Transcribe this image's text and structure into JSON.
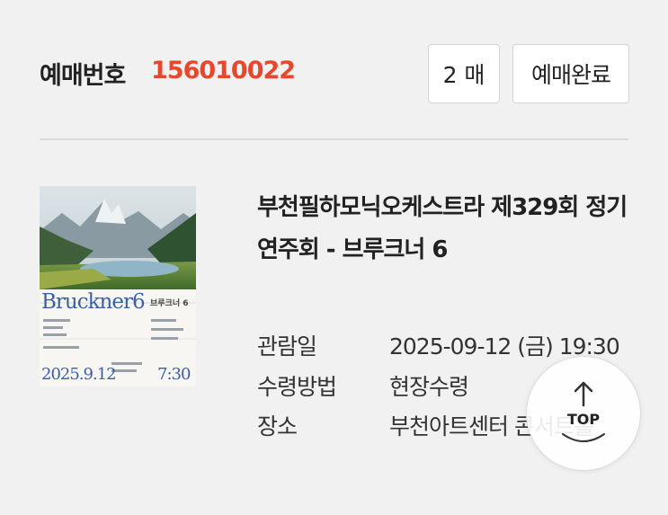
{
  "booking": {
    "label": "예매번호",
    "number": "156010022",
    "ticket_count": "2 매",
    "status": "예매완료"
  },
  "poster": {
    "brand": "Bruckner6",
    "subtitle": "브루크너 6",
    "date": "2025.9.12",
    "time": "7:30"
  },
  "event": {
    "title": "부천필하모닉오케스트라 제329회 정기연주회 - 브루크너 6"
  },
  "details": [
    {
      "label": "관람일",
      "value": "2025-09-12 (금) 19:30"
    },
    {
      "label": "수령방법",
      "value": "현장수령"
    },
    {
      "label": "장소",
      "value": "부천아트센터 콘서트홀"
    }
  ],
  "top_button": {
    "label": "TOP",
    "icon": "arrow-up-icon"
  },
  "colors": {
    "accent": "#e8472b",
    "background": "#f1f1f1",
    "poster_blue": "#3a5ea8"
  }
}
